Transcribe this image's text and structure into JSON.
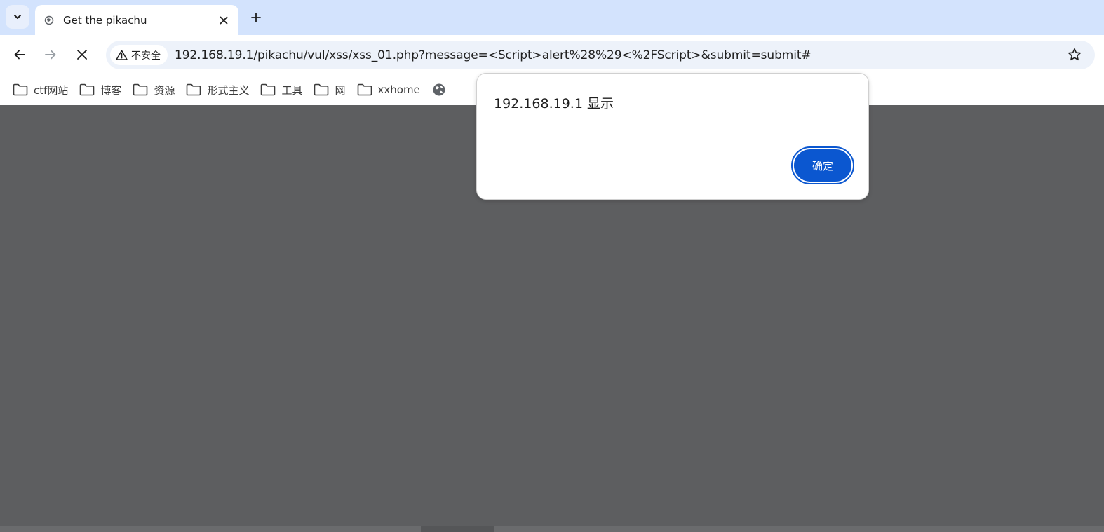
{
  "tab": {
    "title": "Get the pikachu"
  },
  "address_bar": {
    "security_label": "不安全",
    "url": "192.168.19.1/pikachu/vul/xss/xss_01.php?message=<Script>alert%28%29<%2FScript>&submit=submit#"
  },
  "bookmarks": [
    {
      "label": "ctf网站",
      "icon": "folder-icon"
    },
    {
      "label": "博客",
      "icon": "folder-icon"
    },
    {
      "label": "资源",
      "icon": "folder-icon"
    },
    {
      "label": "形式主义",
      "icon": "folder-icon"
    },
    {
      "label": "工具",
      "icon": "folder-icon"
    },
    {
      "label": "网",
      "icon": "folder-icon"
    },
    {
      "label": "xxhome",
      "icon": "folder-icon"
    },
    {
      "label": "",
      "icon": "globe-icon"
    }
  ],
  "dialog": {
    "title": "192.168.19.1 显示",
    "ok_label": "确定"
  },
  "colors": {
    "tabstrip": "#d3e3fd",
    "page_overlay": "#5d5e60",
    "accent": "#0b57d0"
  }
}
